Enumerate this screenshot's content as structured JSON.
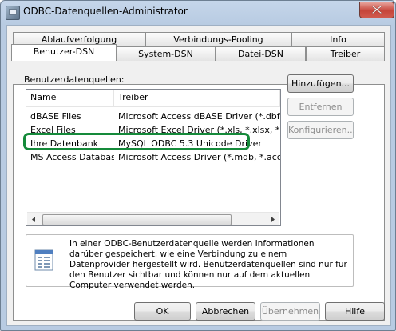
{
  "window": {
    "title": "ODBC-Datenquellen-Administrator"
  },
  "tabs_back": [
    "Ablaufverfolgung",
    "Verbindungs-Pooling",
    "Info"
  ],
  "tabs_front": [
    "Benutzer-DSN",
    "System-DSN",
    "Datei-DSN",
    "Treiber"
  ],
  "active_tab": "Benutzer-DSN",
  "list": {
    "label": "Benutzerdatenquellen:",
    "columns": [
      "Name",
      "Treiber"
    ],
    "rows": [
      {
        "name": "dBASE Files",
        "driver": "Microsoft Access dBASE Driver (*.dbf, *.r"
      },
      {
        "name": "Excel Files",
        "driver": "Microsoft Excel Driver (*.xls, *.xlsx, *.xlsm"
      },
      {
        "name": "Ihre Datenbank",
        "driver": "MySQL ODBC 5.3 Unicode Driver"
      },
      {
        "name": "MS Access Database",
        "driver": "Microsoft Access Driver (*.mdb, *.accdb)"
      }
    ],
    "highlight_color": "#158a3a"
  },
  "side_buttons": {
    "add": "Hinzufügen...",
    "remove": "Entfernen",
    "configure": "Konfigurieren..."
  },
  "info": {
    "text": "In einer ODBC-Benutzerdatenquelle werden Informationen darüber gespeichert, wie eine Verbindung zu einem Datenprovider hergestellt wird. Benutzerdatenquellen sind nur für den Benutzer sichtbar und können nur auf dem aktuellen Computer verwendet werden."
  },
  "footer_buttons": {
    "ok": "OK",
    "cancel": "Abbrechen",
    "apply": "Übernehmen",
    "help": "Hilfe"
  }
}
